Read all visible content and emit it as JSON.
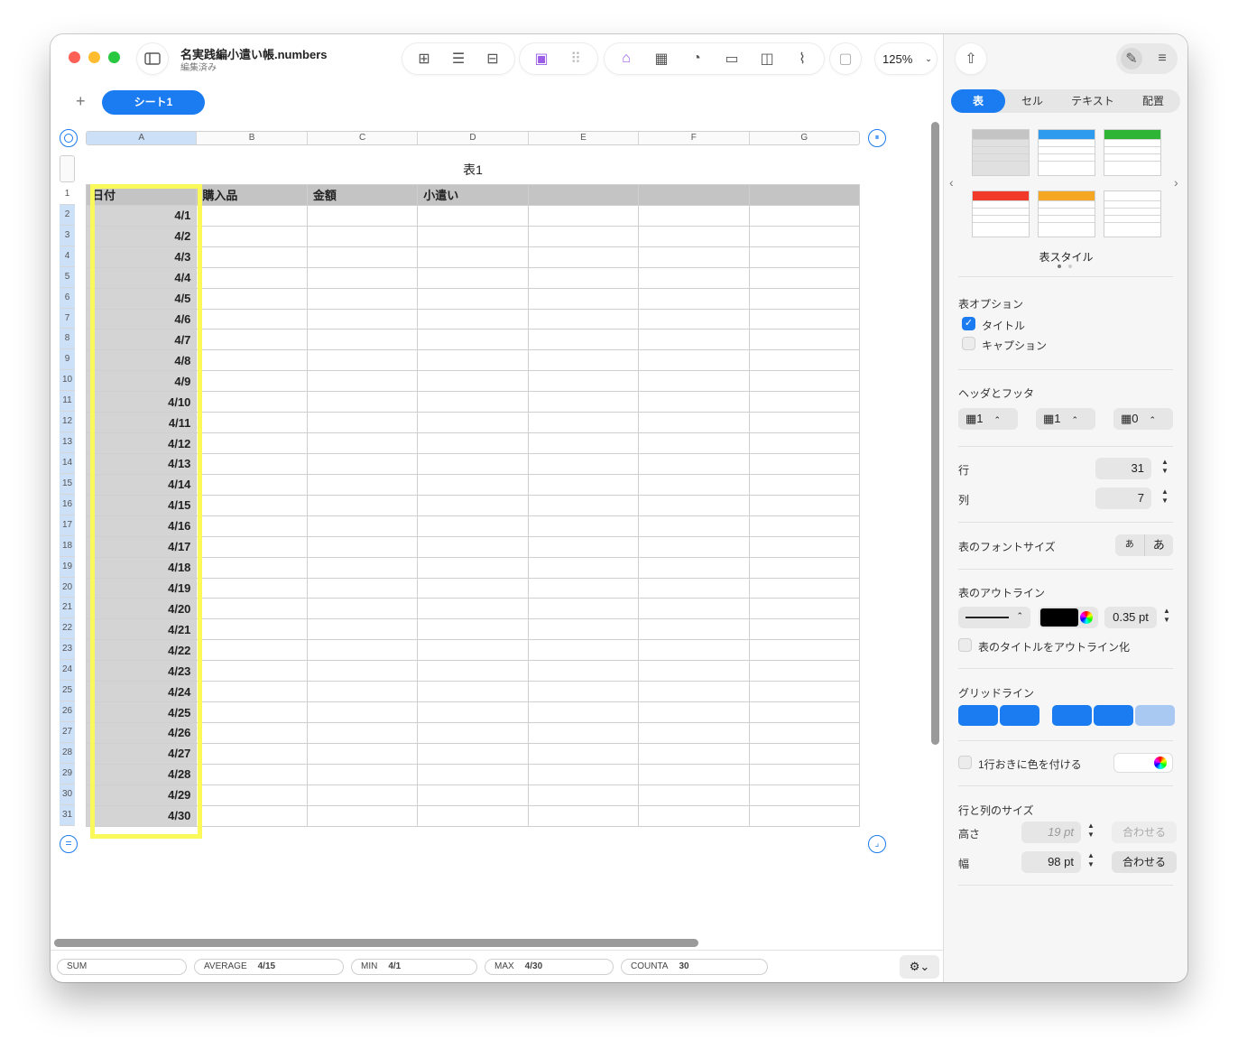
{
  "window": {
    "title": "名実践編小遣い帳.numbers",
    "subtitle": "編集済み"
  },
  "toolbar": {
    "zoom": "125%"
  },
  "sheet": {
    "add": "+",
    "active_tab": "シート1",
    "table_title": "表1"
  },
  "columns": [
    "A",
    "B",
    "C",
    "D",
    "E",
    "F",
    "G"
  ],
  "header_row": [
    "日付",
    "購入品",
    "金額",
    "小遣い",
    "",
    "",
    ""
  ],
  "dates": [
    "4/1",
    "4/2",
    "4/3",
    "4/4",
    "4/5",
    "4/6",
    "4/7",
    "4/8",
    "4/9",
    "4/10",
    "4/11",
    "4/12",
    "4/13",
    "4/14",
    "4/15",
    "4/16",
    "4/17",
    "4/18",
    "4/19",
    "4/20",
    "4/21",
    "4/22",
    "4/23",
    "4/24",
    "4/25",
    "4/26",
    "4/27",
    "4/28",
    "4/29",
    "4/30"
  ],
  "row_numbers": [
    "1",
    "2",
    "3",
    "4",
    "5",
    "6",
    "7",
    "8",
    "9",
    "10",
    "11",
    "12",
    "13",
    "14",
    "15",
    "16",
    "17",
    "18",
    "19",
    "20",
    "21",
    "22",
    "23",
    "24",
    "25",
    "26",
    "27",
    "28",
    "29",
    "30",
    "31"
  ],
  "status": {
    "sum_label": "SUM",
    "average_label": "AVERAGE",
    "average_value": "4/15",
    "min_label": "MIN",
    "min_value": "4/1",
    "max_label": "MAX",
    "max_value": "4/30",
    "counta_label": "COUNTA",
    "counta_value": "30"
  },
  "inspector": {
    "tabs": [
      "表",
      "セル",
      "テキスト",
      "配置"
    ],
    "styles_label": "表スタイル",
    "table_options_label": "表オプション",
    "title_option": "タイトル",
    "caption_option": "キャプション",
    "header_footer_label": "ヘッダとフッタ",
    "header_rows": "1",
    "header_cols": "1",
    "footer_rows": "0",
    "rows_label": "行",
    "rows_value": "31",
    "cols_label": "列",
    "cols_value": "7",
    "font_size_label": "表のフォントサイズ",
    "font_small": "あ",
    "font_large": "あ",
    "outline_label": "表のアウトライン",
    "outline_width": "0.35 pt",
    "outline_title_option": "表のタイトルをアウトライン化",
    "gridlines_label": "グリッドライン",
    "alternate_label": "1行おきに色を付ける",
    "size_label": "行と列のサイズ",
    "height_label": "高さ",
    "height_value": "19 pt",
    "fit1": "合わせる",
    "width_label": "幅",
    "width_value": "98 pt",
    "fit2": "合わせる"
  },
  "colors": {
    "accent": "#1a7cf0",
    "highlight": "#fbf85a",
    "header_gray": "#c4c4c4",
    "style_blue": "#2f9bef",
    "style_green": "#2fb536",
    "style_red": "#f13a2a",
    "style_orange": "#f5a623"
  }
}
